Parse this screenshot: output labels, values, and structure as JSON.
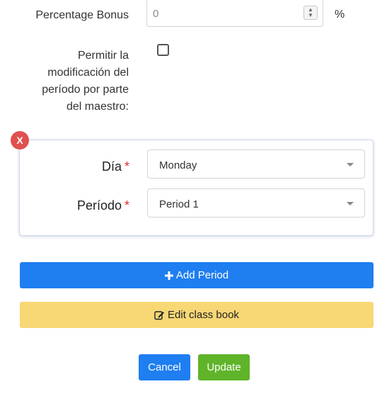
{
  "percentage_bonus": {
    "label": "Percentage Bonus",
    "value": "0",
    "unit": "%"
  },
  "teacher_modify": {
    "label_lines": [
      "Permitir la",
      "modificación del",
      "período por parte",
      "del maestro:"
    ],
    "checked": false
  },
  "period_card": {
    "remove_label": "X",
    "day_label": "Día",
    "day_value": "Monday",
    "period_label": "Período",
    "period_value": "Period 1",
    "required_marker": "*"
  },
  "actions": {
    "add_period_label": "Add Period",
    "edit_class_book_label": "Edit class book",
    "cancel_label": "Cancel",
    "update_label": "Update"
  },
  "colors": {
    "primary": "#1f7ef0",
    "warning": "#f8d775",
    "success": "#5fb42a",
    "danger": "#e0504e"
  },
  "icons": {
    "add": "plus-icon",
    "edit": "edit-icon",
    "remove": "close-icon"
  }
}
